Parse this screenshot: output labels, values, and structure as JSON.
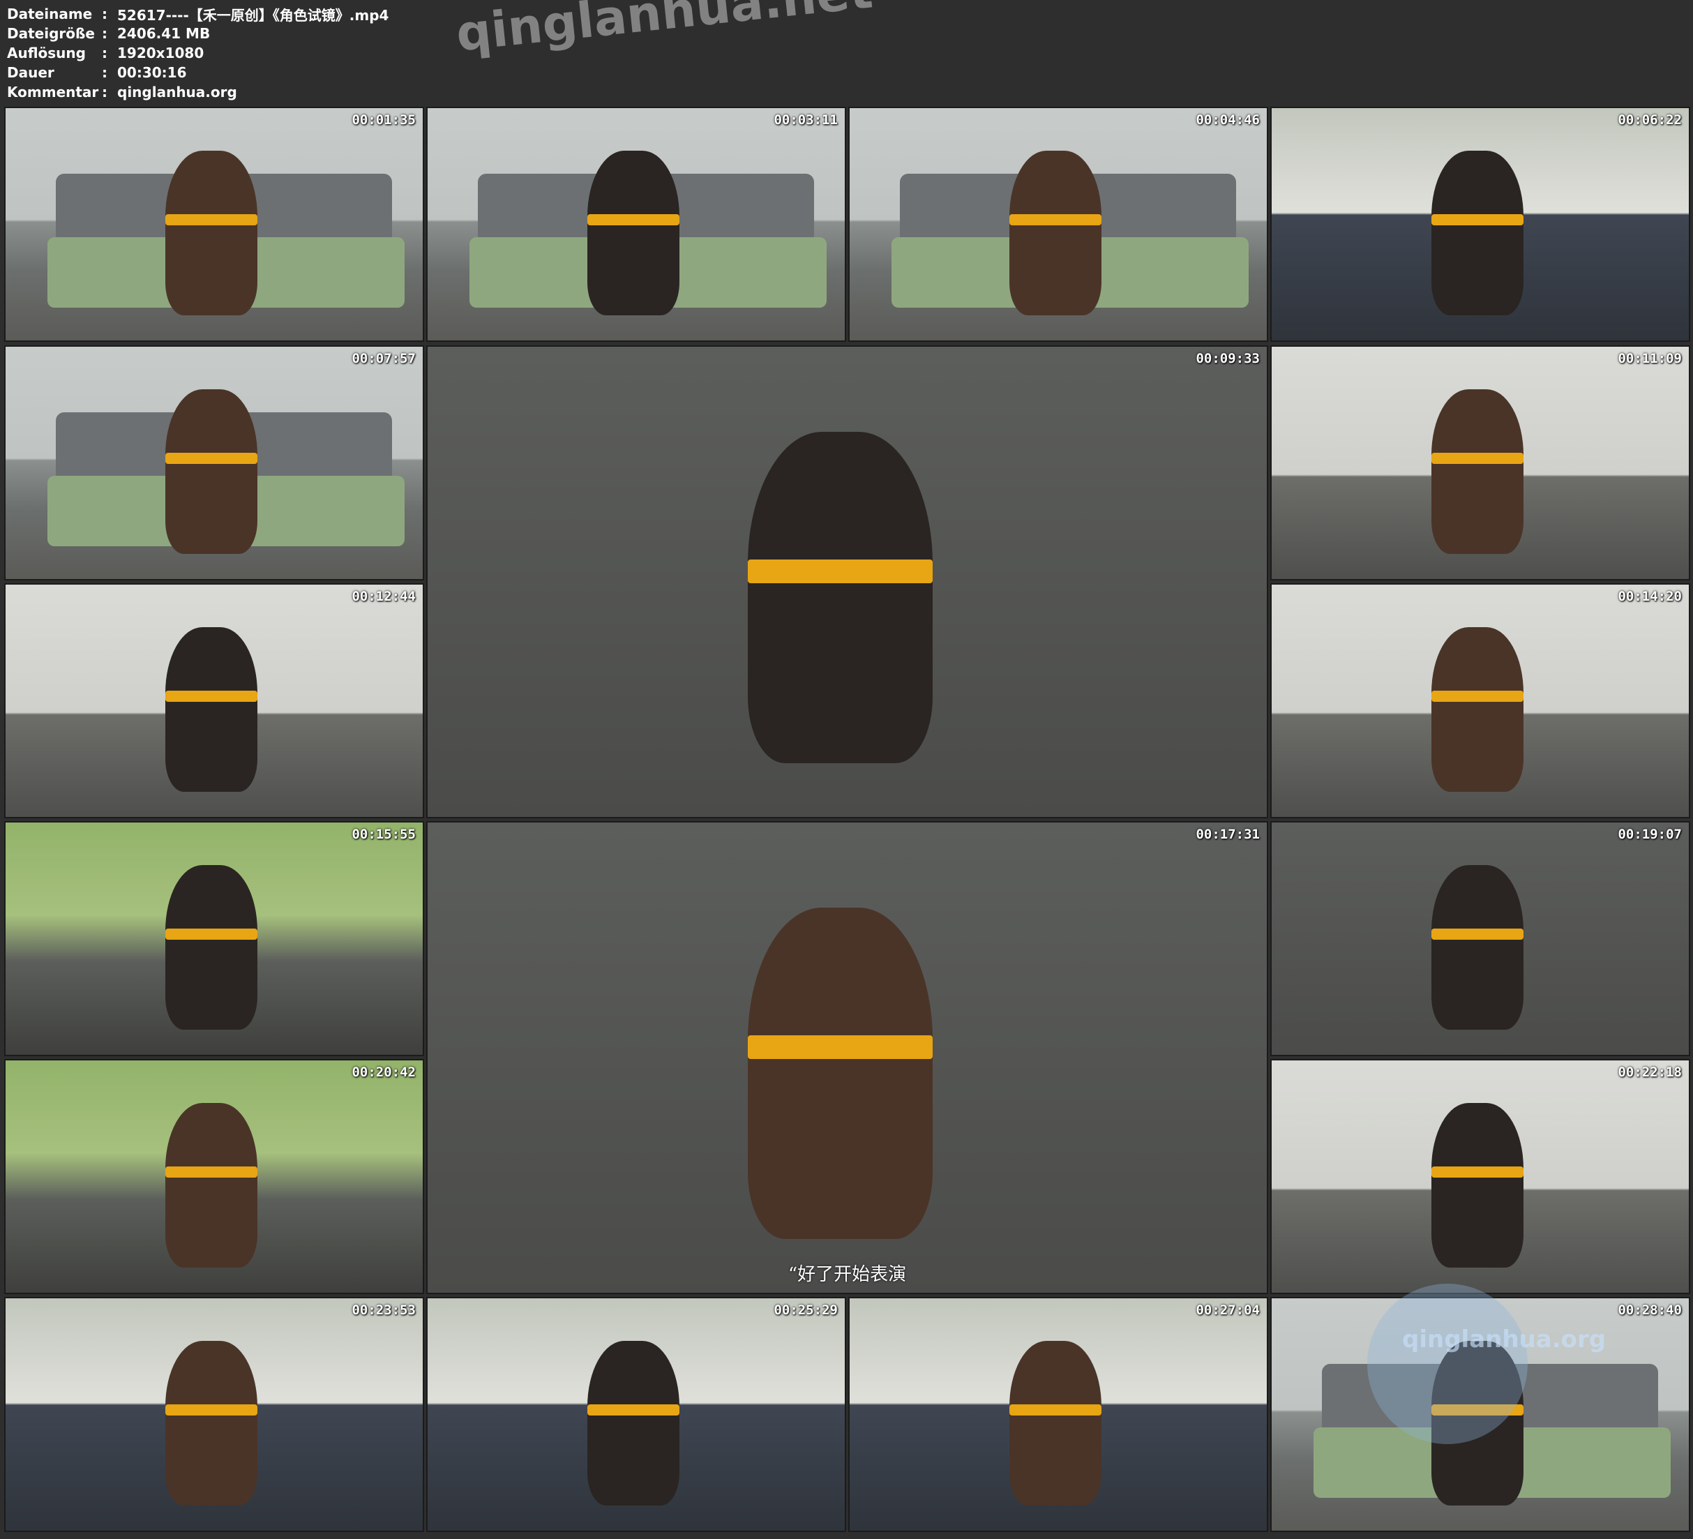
{
  "file_info": {
    "rows": [
      {
        "key": "Dateiname",
        "sep": ":",
        "value": "52617----【禾一原创】《角色试镜》.mp4"
      },
      {
        "key": "Dateigröße",
        "sep": ":",
        "value": "2406.41 MB"
      },
      {
        "key": "Auflösung",
        "sep": ":",
        "value": "1920x1080"
      },
      {
        "key": "Dauer",
        "sep": ":",
        "value": "00:30:16"
      },
      {
        "key": "Kommentar",
        "sep": ":",
        "value": "qinglanhua.org"
      }
    ]
  },
  "watermarks": {
    "top": "qinglanhua.net",
    "corner": "qinglanhua.org"
  },
  "thumbnails": [
    {
      "time": "00:01:35",
      "scene": "living"
    },
    {
      "time": "00:03:11",
      "scene": "living"
    },
    {
      "time": "00:04:46",
      "scene": "living"
    },
    {
      "time": "00:06:22",
      "scene": "bed"
    },
    {
      "time": "00:07:57",
      "scene": "living"
    },
    {
      "time": "00:09:33",
      "scene": "floor"
    },
    {
      "time": "00:11:09",
      "scene": "room"
    },
    {
      "time": "00:12:44",
      "scene": "room"
    },
    {
      "time": "00:14:20",
      "scene": "room"
    },
    {
      "time": "00:15:55",
      "scene": "green"
    },
    {
      "time": "00:17:31",
      "scene": "floor",
      "subtitle": "“好了开始表演"
    },
    {
      "time": "00:19:07",
      "scene": "floor"
    },
    {
      "time": "00:20:42",
      "scene": "green"
    },
    {
      "time": "00:22:18",
      "scene": "room"
    },
    {
      "time": "00:23:53",
      "scene": "bed"
    },
    {
      "time": "00:25:29",
      "scene": "bed"
    },
    {
      "time": "00:27:04",
      "scene": "bed"
    },
    {
      "time": "00:28:40",
      "scene": "living"
    }
  ]
}
